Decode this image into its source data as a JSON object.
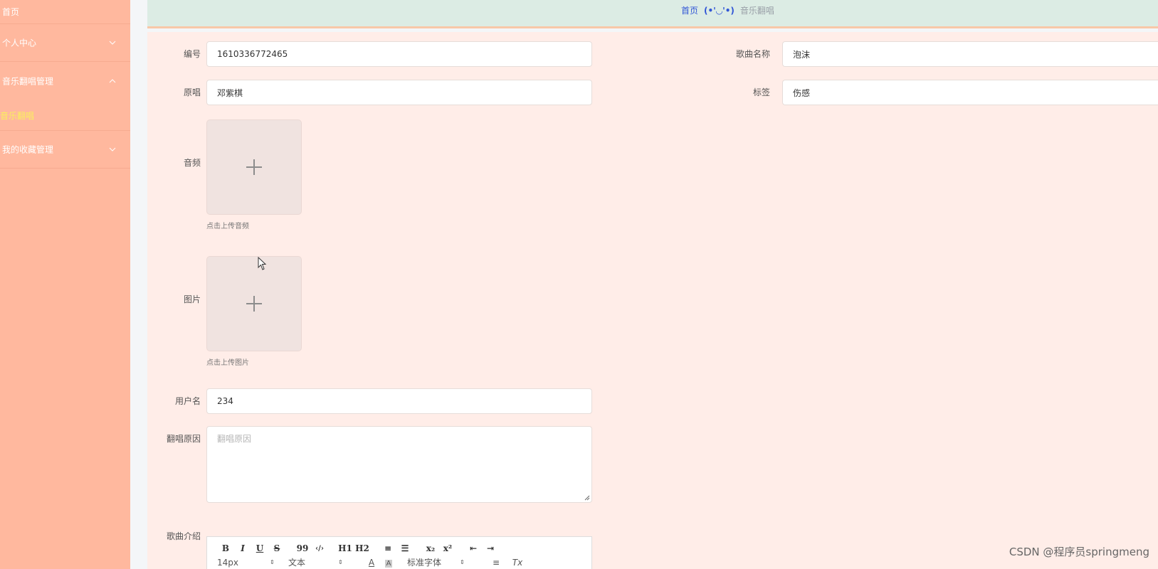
{
  "sidebar": {
    "home": "首页",
    "personal": "个人中心",
    "music_group": "音乐翻唱管理",
    "music_sub": "音乐翻唱",
    "favorites": "我的收藏管理"
  },
  "breadcrumb": {
    "home": "首页",
    "separator": "(•'◡'•)",
    "current": "音乐翻唱"
  },
  "form": {
    "id_label": "编号",
    "id_value": "1610336772465",
    "song_label": "歌曲名称",
    "song_value": "泡沫",
    "singer_label": "原唱",
    "singer_value": "邓紫棋",
    "tag_label": "标签",
    "tag_value": "伤感",
    "audio_label": "音频",
    "audio_tip": "点击上传音频",
    "image_label": "图片",
    "image_tip": "点击上传图片",
    "username_label": "用户名",
    "username_value": "234",
    "reason_label": "翻唱原因",
    "reason_placeholder": "翻唱原因",
    "intro_label": "歌曲介绍"
  },
  "editor": {
    "row1": [
      "B",
      "I",
      "U",
      "S",
      "99",
      "‹/›",
      "H1",
      "H2",
      "≡",
      "☰",
      "x₂",
      "x²",
      "⇤",
      "⇥"
    ],
    "font_size": "14px",
    "text_type": "文本",
    "font_family": "标准字体"
  },
  "watermark": "CSDN @程序员springmeng"
}
